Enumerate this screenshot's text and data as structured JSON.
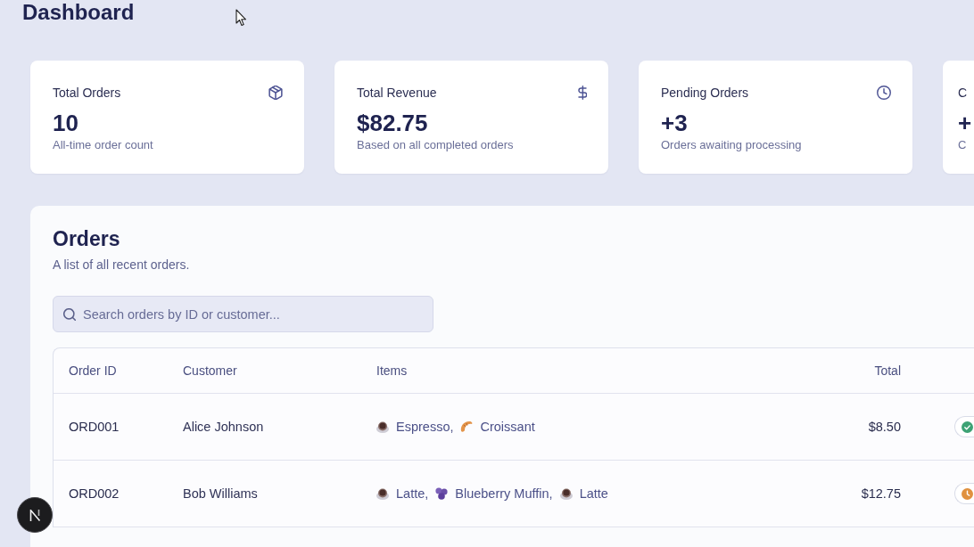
{
  "page": {
    "title": "Dashboard"
  },
  "stats": [
    {
      "title": "Total Orders",
      "value": "10",
      "description": "All-time order count",
      "kind": "package"
    },
    {
      "title": "Total Revenue",
      "value": "$82.75",
      "description": "Based on all completed orders",
      "kind": "dollar"
    },
    {
      "title": "Pending Orders",
      "value": "+3",
      "description": "Orders awaiting processing",
      "kind": "clock"
    },
    {
      "title": "C",
      "value": "+",
      "description": "C"
    }
  ],
  "orders": {
    "title": "Orders",
    "subtitle": "A list of all recent orders.",
    "search": {
      "placeholder": "Search orders by ID or customer..."
    },
    "columns": [
      "Order ID",
      "Customer",
      "Items",
      "Total"
    ],
    "rows": [
      {
        "order_id": "ORD001",
        "customer": "Alice Johnson",
        "items": [
          {
            "name": "Espresso,",
            "kind": "coffee"
          },
          {
            "name": "Croissant",
            "kind": "croissant"
          }
        ],
        "total": "$8.50",
        "badge": {
          "kind": "check",
          "color": "#3da274"
        }
      },
      {
        "order_id": "ORD002",
        "customer": "Bob Williams",
        "items": [
          {
            "name": "Latte,",
            "kind": "coffee"
          },
          {
            "name": "Blueberry Muffin,",
            "kind": "blueberries"
          },
          {
            "name": "Latte",
            "kind": "coffee"
          }
        ],
        "total": "$12.75",
        "badge": {
          "kind": "clock",
          "color": "#e0913f"
        }
      }
    ]
  }
}
